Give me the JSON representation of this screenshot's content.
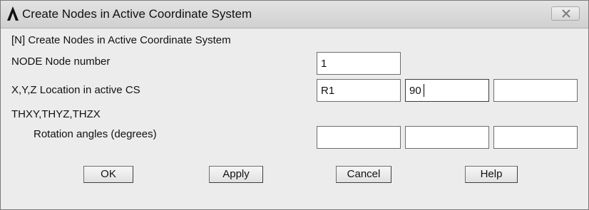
{
  "window": {
    "title": "Create Nodes in Active Coordinate System"
  },
  "icons": {
    "app_logo": "ansys-logo-icon",
    "close": "close-icon"
  },
  "form": {
    "heading": "[N]  Create Nodes in Active Coordinate System",
    "node": {
      "label": "NODE   Node number",
      "value": "1"
    },
    "location": {
      "label": "X,Y,Z  Location in active CS",
      "x_value": "R1",
      "y_value": "90",
      "z_value": ""
    },
    "rotation": {
      "label_top": "THXY,THYZ,THZX",
      "label_bottom": "Rotation angles (degrees)",
      "thxy_value": "",
      "thyz_value": "",
      "thzx_value": ""
    }
  },
  "buttons": {
    "ok": "OK",
    "apply": "Apply",
    "cancel": "Cancel",
    "help": "Help"
  }
}
